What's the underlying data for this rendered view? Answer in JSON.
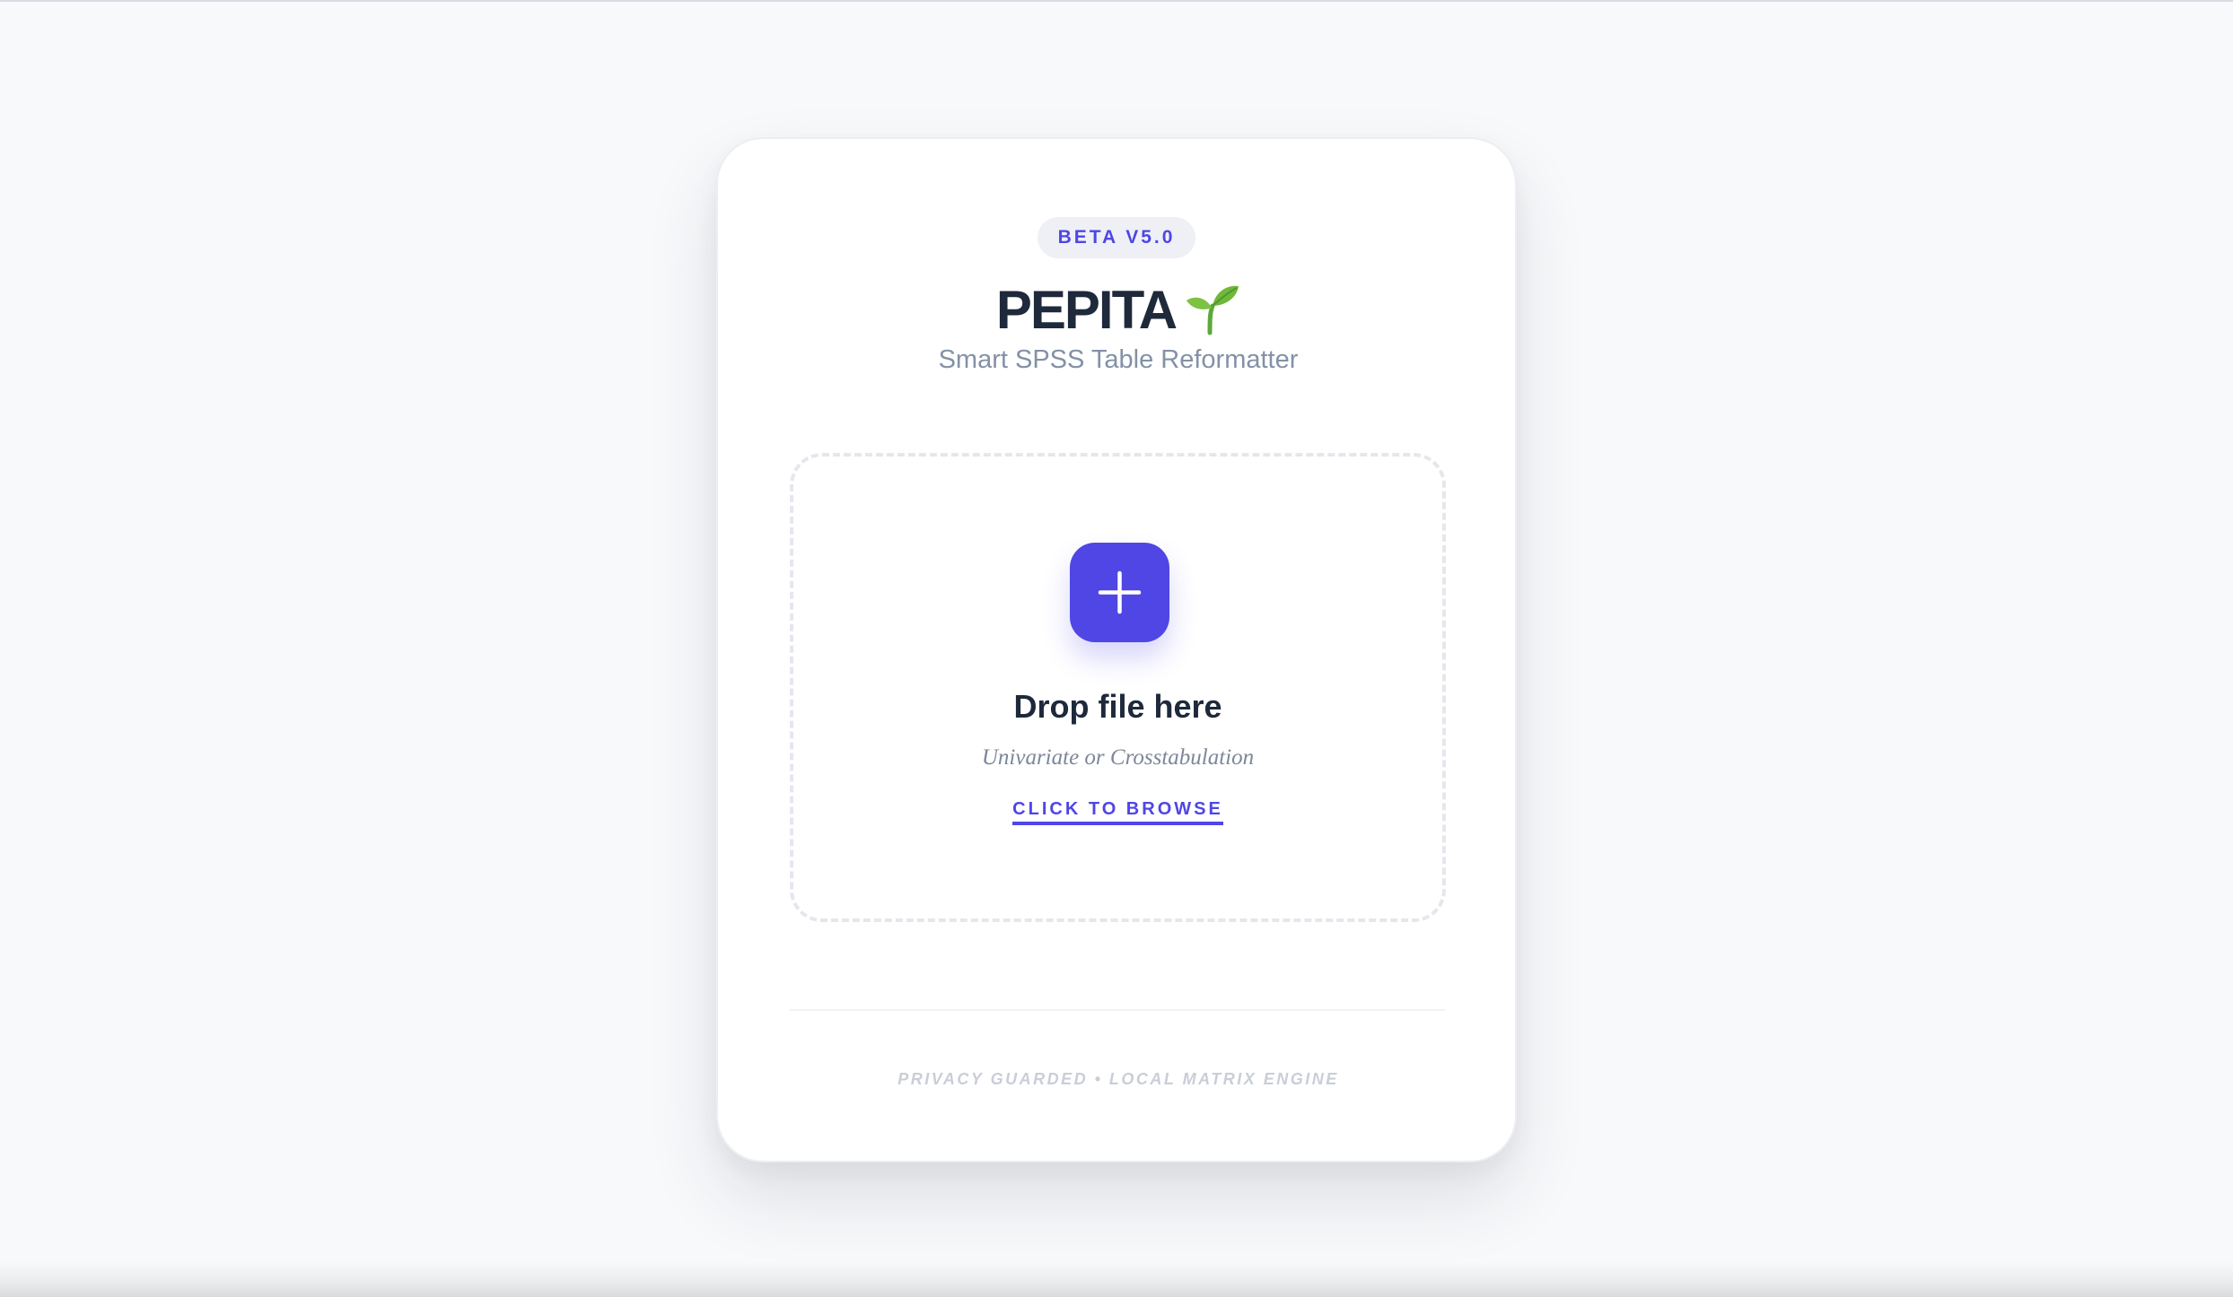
{
  "app": {
    "badge": "BETA V5.0",
    "title": "PEPITA",
    "subtitle": "Smart SPSS Table Reformatter",
    "title_icon": "sprout-icon"
  },
  "upload": {
    "add_icon": "plus-icon",
    "heading": "Drop file here",
    "hint": "Univariate or Crosstabulation",
    "browse_label": "CLICK TO BROWSE"
  },
  "footer": {
    "text": "PRIVACY GUARDED • LOCAL MATRIX ENGINE"
  },
  "colors": {
    "accent": "#4f46e5",
    "heading": "#1e293b",
    "muted": "#8391a7",
    "background": "#f8f9fb",
    "sprout": "#6fb83a"
  }
}
